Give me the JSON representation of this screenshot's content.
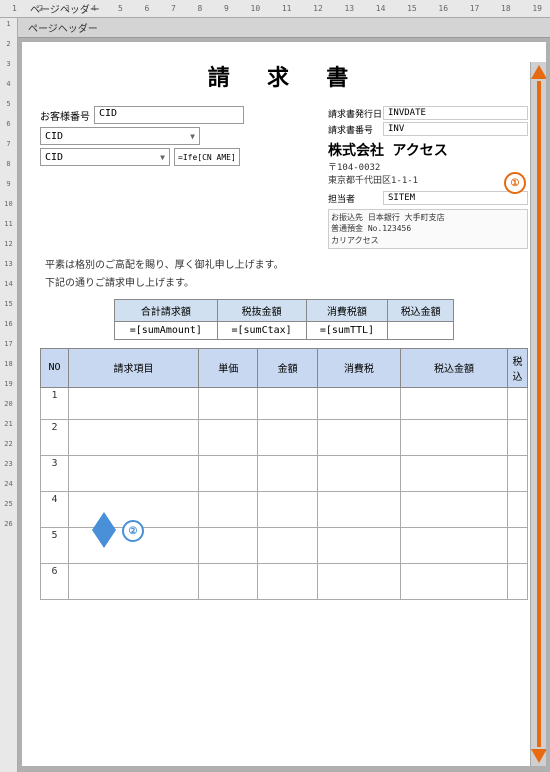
{
  "ruler": {
    "top_label": "ページヘッダー",
    "numbers": [
      "1",
      "2",
      "3",
      "4",
      "5",
      "6",
      "7",
      "8",
      "9",
      "10",
      "11",
      "12",
      "13",
      "14",
      "15",
      "16",
      "17",
      "18",
      "19"
    ],
    "left_numbers": [
      "1",
      "2",
      "3",
      "4",
      "5",
      "6",
      "7",
      "8",
      "9",
      "10",
      "11",
      "12",
      "13",
      "14",
      "15",
      "16",
      "17",
      "18",
      "19",
      "20",
      "21",
      "22",
      "23",
      "24",
      "25",
      "26"
    ]
  },
  "page": {
    "title": "請 求 書"
  },
  "customer": {
    "label": "お客様番号",
    "cid1_value": "CID",
    "cid2_value": "CID",
    "cid3_value": "CID",
    "formula_name": "=Ife[CN AME]"
  },
  "invoice": {
    "issue_date_label": "請求書発行日",
    "issue_date_value": "INVDATE",
    "number_label": "請求書番号",
    "number_value": "INV"
  },
  "company": {
    "name": "株式会社 アクセス",
    "postal": "〒104-0032",
    "address": "東京都千代田区1-1-1"
  },
  "contact": {
    "label": "担当者",
    "value": "SITEM"
  },
  "bank": {
    "label": "お振込先",
    "info": "日本銀行 大手町支店\n普通預金 No.123456\nカリアクセス"
  },
  "message": {
    "line1": "平素は格別のご高配を賜り、厚く御礼申し上げます。",
    "line2": "下記の通りご請求申し上げます。"
  },
  "totals": {
    "col1_header": "合計請求額",
    "col2_header": "税抜金額",
    "col3_header": "消費税額",
    "col4_header": "税込金額",
    "col1_value": "=[sumAmount]",
    "col2_value": "=[sumCtax]",
    "col3_value": "=[sumTTL]"
  },
  "table": {
    "headers": [
      "NO",
      "請求項目",
      "単価",
      "金額",
      "消費税",
      "税込金額",
      "税込"
    ],
    "rows": [
      {
        "no": "1"
      },
      {
        "no": "2"
      },
      {
        "no": "3"
      },
      {
        "no": "4"
      },
      {
        "no": "5"
      },
      {
        "no": "6"
      }
    ]
  },
  "badges": {
    "badge1": "①",
    "badge2": "②"
  },
  "colors": {
    "orange": "#e86a10",
    "blue": "#4a90d9",
    "table_header_bg": "#c8d8f0",
    "totals_header_bg": "#d0e0f0"
  }
}
